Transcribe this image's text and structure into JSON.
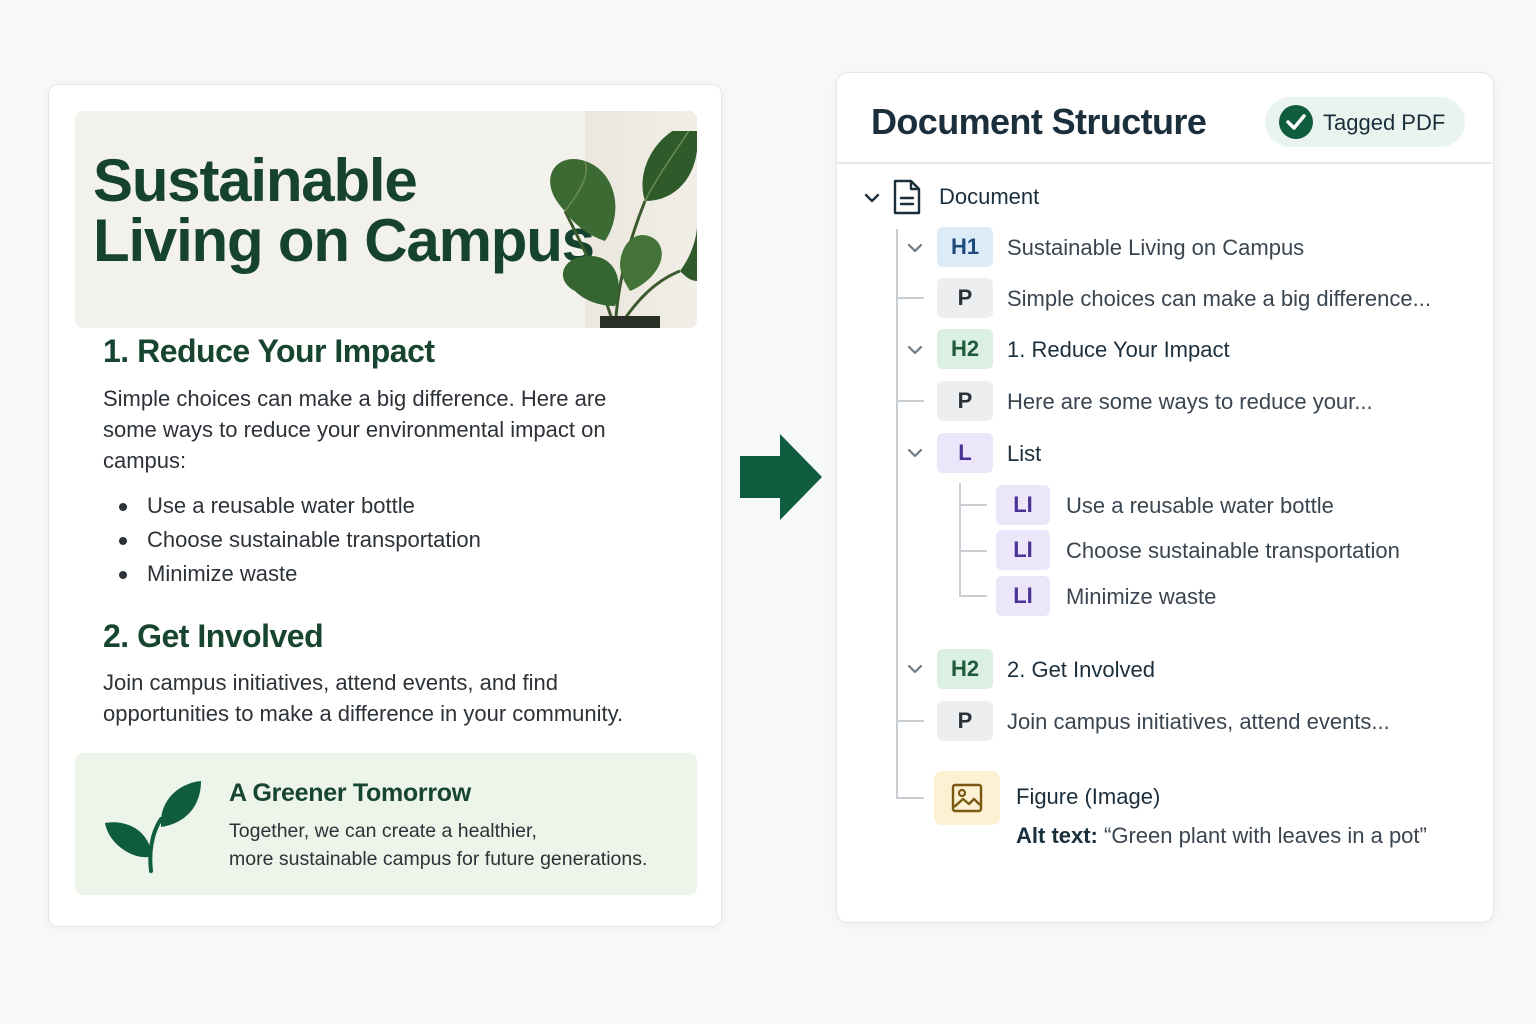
{
  "document": {
    "hero_title_line1": "Sustainable",
    "hero_title_line2": "Living on Campus",
    "section1_heading": "1. Reduce Your Impact",
    "section1_paragraph": "Simple choices can make a big difference. Here are some ways to reduce your environmental impact on campus:",
    "bullets": [
      "Use a reusable water bottle",
      "Choose sustainable transportation",
      "Minimize waste"
    ],
    "section2_heading": "2. Get Involved",
    "section2_paragraph": "Join campus initiatives, attend events, and find opportunities to make a difference in your community.",
    "callout_title": "A Greener Tomorrow",
    "callout_line1": "Together, we can create a healthier,",
    "callout_line2": "more sustainable campus for future generations."
  },
  "structure": {
    "title": "Document Structure",
    "badge_label": "Tagged PDF",
    "root_label": "Document",
    "nodes": [
      {
        "tag": "H1",
        "text": "Sustainable Living on Campus"
      },
      {
        "tag": "P",
        "text": "Simple choices can make a big difference..."
      },
      {
        "tag": "H2",
        "text": "1. Reduce Your Impact"
      },
      {
        "tag": "P",
        "text": "Here are some ways to reduce your..."
      },
      {
        "tag": "L",
        "text": "List"
      },
      {
        "tag": "LI",
        "text": "Use a reusable water bottle"
      },
      {
        "tag": "LI",
        "text": "Choose sustainable transportation"
      },
      {
        "tag": "LI",
        "text": "Minimize waste"
      },
      {
        "tag": "H2",
        "text": "2. Get Involved"
      },
      {
        "tag": "P",
        "text": "Join campus initiatives, attend events..."
      }
    ],
    "figure_label": "Figure (Image)",
    "alt_label": "Alt text:",
    "alt_value": "“Green plant with leaves in a pot”"
  },
  "colors": {
    "brand_green": "#0f5c3f",
    "heading_green": "#17452f",
    "callout_bg": "#edf4e9"
  },
  "icons": [
    "plant-illustration",
    "leaf-icon",
    "arrow-right-icon",
    "check-icon",
    "chevron-down-icon",
    "document-icon",
    "image-icon"
  ]
}
